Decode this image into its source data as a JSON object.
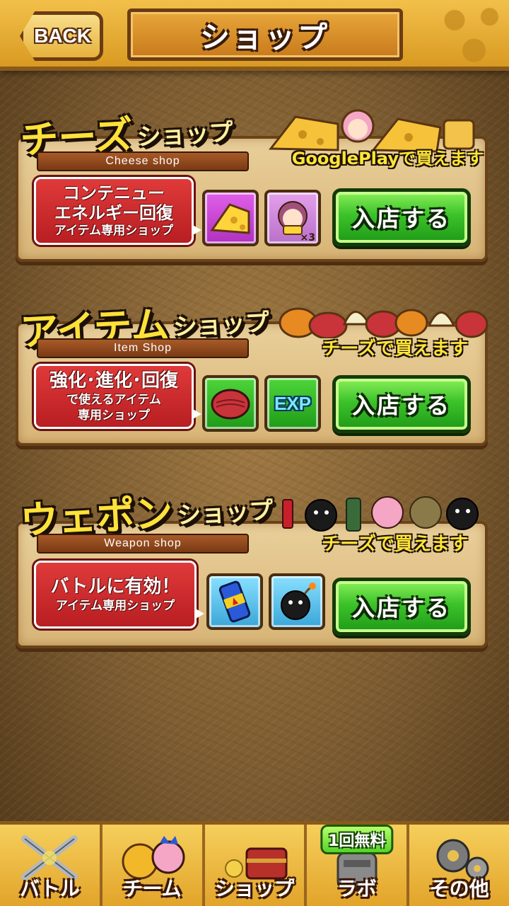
{
  "header": {
    "back_label": "BACK",
    "title": "ショップ"
  },
  "shops": [
    {
      "title_big": "チーズ",
      "title_small": "ショップ",
      "ribbon": "Cheese shop",
      "buy_note": "GooglePlayで買えます",
      "label_line1": "コンテニュー",
      "label_line2": "エネルギー回復",
      "label_line3": "アイテム専用ショップ",
      "items": [
        "cheese-icon",
        "girl-with-cheese-icon"
      ],
      "item_badge": "×3",
      "enter_label": "入店する"
    },
    {
      "title_big": "アイテム",
      "title_small": "ショップ",
      "ribbon": "Item Shop",
      "buy_note": "チーズで買えます",
      "label_line1": "強化･進化･回復",
      "label_line2": "で使えるアイテム",
      "label_line3": "専用ショップ",
      "items": [
        "meat-bun-icon",
        "exp-icon"
      ],
      "exp_text": "EXP",
      "enter_label": "入店する"
    },
    {
      "title_big": "ウェポン",
      "title_small": "ショップ",
      "ribbon": "Weapon shop",
      "buy_note": "チーズで買えます",
      "label_line1": "バトルに有効！",
      "label_line2": "アイテム専用ショップ",
      "items": [
        "energy-drink-icon",
        "bomb-icon"
      ],
      "enter_label": "入店する"
    }
  ],
  "bottom_nav": {
    "items": [
      {
        "label": "バトル",
        "icon": "crossed-swords-icon"
      },
      {
        "label": "チーム",
        "icon": "team-characters-icon"
      },
      {
        "label": "ショップ",
        "icon": "treasure-chest-icon"
      },
      {
        "label": "ラボ",
        "icon": "lab-icon",
        "badge": "1回無料"
      },
      {
        "label": "その他",
        "icon": "gears-icon"
      }
    ]
  },
  "colors": {
    "title_yellow": "#ffe13a",
    "enter_green": "#3cc22a",
    "label_red": "#d02a2c",
    "panel_parchment": "#e2c387"
  }
}
